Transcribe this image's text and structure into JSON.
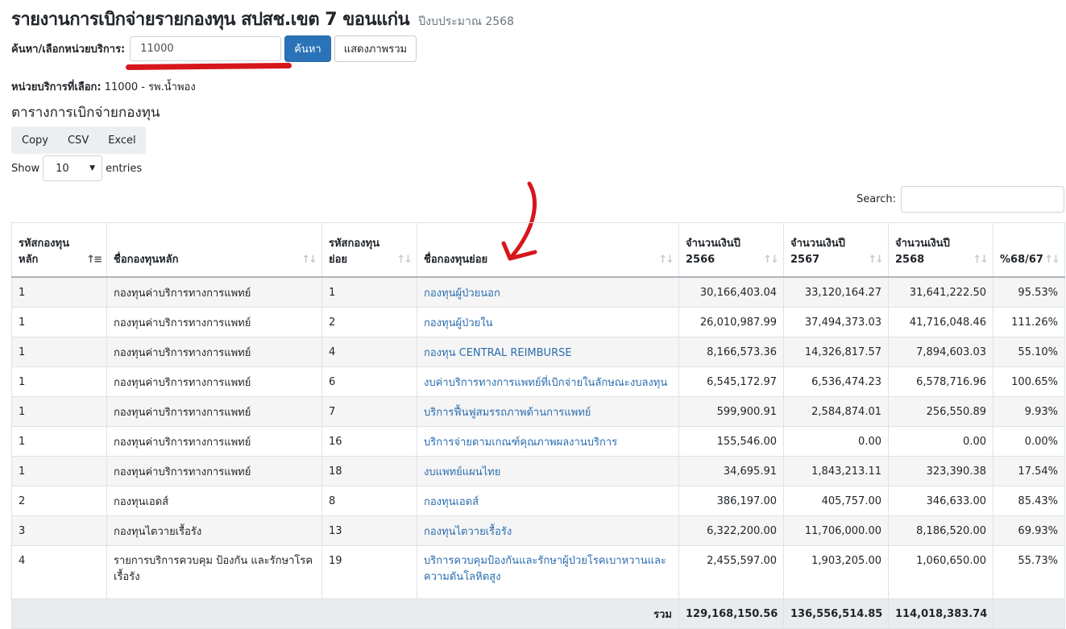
{
  "header": {
    "title": "รายงานการเบิกจ่ายรายกองทุน สปสช.เขต 7 ขอนแก่น",
    "subtitle": "ปีงบประมาณ 2568"
  },
  "search": {
    "label": "ค้นหา/เลือกหน่วยบริการ:",
    "value": "11000",
    "search_button": "ค้นหา",
    "overview_button": "แสดงภาพรวม"
  },
  "selected_unit": {
    "label": "หน่วยบริการที่เลือก:",
    "value": "11000 - รพ.น้ำพอง"
  },
  "section_title": "ตารางการเบิกจ่ายกองทุน",
  "export_buttons": [
    "Copy",
    "CSV",
    "Excel"
  ],
  "length_menu": {
    "prefix": "Show",
    "value": "10",
    "suffix": "entries"
  },
  "table_search": {
    "label": "Search:",
    "value": ""
  },
  "table": {
    "columns": [
      "รหัสกองทุนหลัก",
      "ชื่อกองทุนหลัก",
      "รหัสกองทุนย่อย",
      "ชื่อกองทุนย่อย",
      "จำนวนเงินปี 2566",
      "จำนวนเงินปี 2567",
      "จำนวนเงินปี 2568",
      "%68/67"
    ],
    "rows": [
      [
        "1",
        "กองทุนค่าบริการทางการแพทย์",
        "1",
        "กองทุนผู้ป่วยนอก",
        "30,166,403.04",
        "33,120,164.27",
        "31,641,222.50",
        "95.53%"
      ],
      [
        "1",
        "กองทุนค่าบริการทางการแพทย์",
        "2",
        "กองทุนผู้ป่วยใน",
        "26,010,987.99",
        "37,494,373.03",
        "41,716,048.46",
        "111.26%"
      ],
      [
        "1",
        "กองทุนค่าบริการทางการแพทย์",
        "4",
        "กองทุน CENTRAL REIMBURSE",
        "8,166,573.36",
        "14,326,817.57",
        "7,894,603.03",
        "55.10%"
      ],
      [
        "1",
        "กองทุนค่าบริการทางการแพทย์",
        "6",
        "งบค่าบริการทางการแพทย์ที่เบิกจ่ายในลักษณะงบลงทุน",
        "6,545,172.97",
        "6,536,474.23",
        "6,578,716.96",
        "100.65%"
      ],
      [
        "1",
        "กองทุนค่าบริการทางการแพทย์",
        "7",
        "บริการฟื้นฟูสมรรถภาพด้านการแพทย์",
        "599,900.91",
        "2,584,874.01",
        "256,550.89",
        "9.93%"
      ],
      [
        "1",
        "กองทุนค่าบริการทางการแพทย์",
        "16",
        "บริการจ่ายตามเกณฑ์คุณภาพผลงานบริการ",
        "155,546.00",
        "0.00",
        "0.00",
        "0.00%"
      ],
      [
        "1",
        "กองทุนค่าบริการทางการแพทย์",
        "18",
        "งบแพทย์แผนไทย",
        "34,695.91",
        "1,843,213.11",
        "323,390.38",
        "17.54%"
      ],
      [
        "2",
        "กองทุนเอดส์",
        "8",
        "กองทุนเอดส์",
        "386,197.00",
        "405,757.00",
        "346,633.00",
        "85.43%"
      ],
      [
        "3",
        "กองทุนไตวายเรื้อรัง",
        "13",
        "กองทุนไตวายเรื้อรัง",
        "6,322,200.00",
        "11,706,000.00",
        "8,186,520.00",
        "69.93%"
      ],
      [
        "4",
        "รายการบริการควบคุม ป้องกัน และรักษาโรคเรื้อรัง",
        "19",
        "บริการควบคุมป้องกันและรักษาผู้ป่วยโรคเบาหวานและความดันโลหิตสูง",
        "2,455,597.00",
        "1,903,205.00",
        "1,060,650.00",
        "55.73%"
      ]
    ],
    "footer": {
      "label": "รวม",
      "total_2566": "129,168,150.56",
      "total_2567": "136,556,514.85",
      "total_2568": "114,018,383.74"
    }
  },
  "sort_icons": {
    "active": "sort-ascending-icon",
    "inactive": "sort-both-icon"
  },
  "annotations": {
    "underline_color": "#d7161c",
    "arrow_color": "#d7161c"
  },
  "colors": {
    "primary": "#2a73b8",
    "link": "#2a6db0"
  }
}
